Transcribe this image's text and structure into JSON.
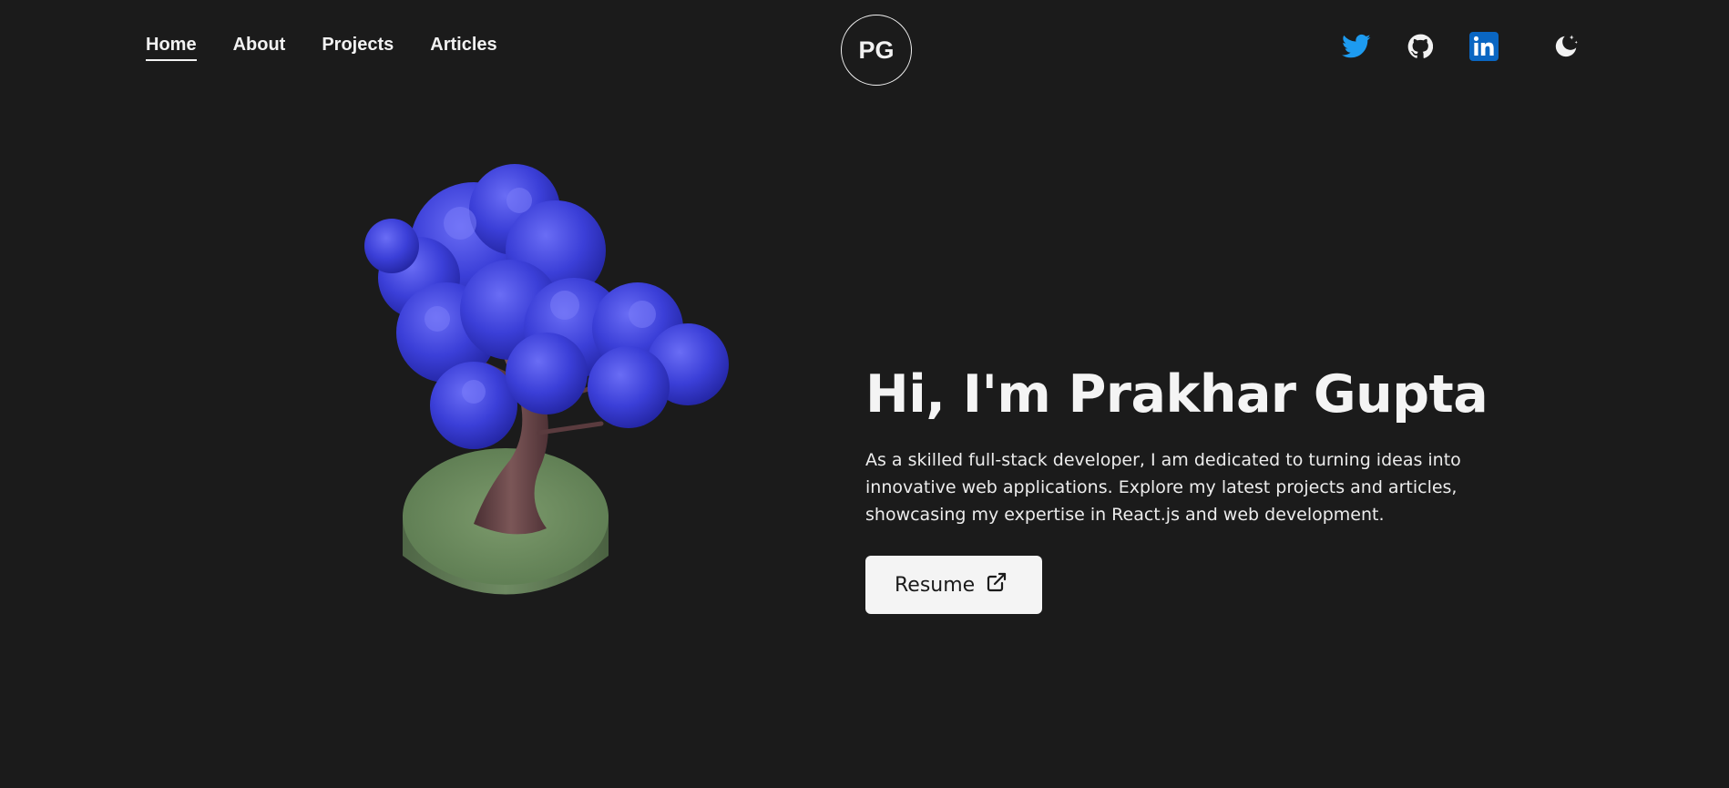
{
  "nav": {
    "items": [
      {
        "label": "Home",
        "active": true
      },
      {
        "label": "About",
        "active": false
      },
      {
        "label": "Projects",
        "active": false
      },
      {
        "label": "Articles",
        "active": false
      }
    ]
  },
  "logo": {
    "initials": "PG"
  },
  "social": {
    "icons": [
      "twitter-icon",
      "github-icon",
      "linkedin-icon",
      "moon-icon"
    ],
    "colors": {
      "twitter": "#1d9bf0",
      "github": "#f2f2f2",
      "linkedin": "#0a66c2",
      "theme": "#f2f2f2"
    }
  },
  "hero": {
    "title": "Hi, I'm Prakhar Gupta",
    "description": "As a skilled full-stack developer, I am dedicated to turning ideas into innovative web applications. Explore my latest projects and articles, showcasing my expertise in React.js and web development.",
    "resume_label": "Resume"
  },
  "colors": {
    "background": "#1b1b1b",
    "text": "#f2f2f2",
    "button_bg": "#f4f4f4",
    "foliage": "#3b3fd8",
    "trunk": "#6b4a4a",
    "pot": "#6e8a62"
  }
}
